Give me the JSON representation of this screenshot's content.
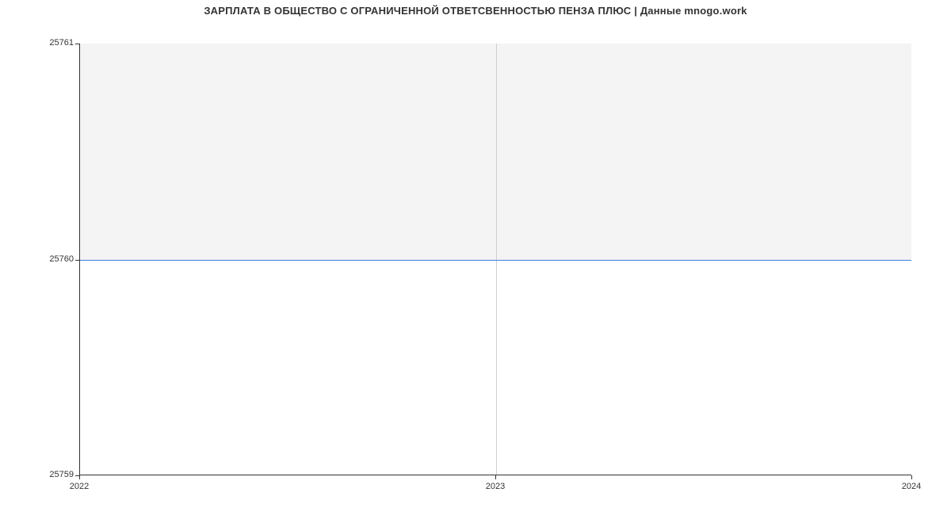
{
  "chart_data": {
    "type": "line",
    "title": "ЗАРПЛАТА В ОБЩЕСТВО С ОГРАНИЧЕННОЙ ОТВЕТСВЕННОСТЬЮ ПЕНЗА ПЛЮС | Данные mnogo.work",
    "xlabel": "",
    "ylabel": "",
    "x": [
      "2022",
      "2023",
      "2024"
    ],
    "values": [
      25760,
      25760,
      25760
    ],
    "xlim": [
      "2022",
      "2024"
    ],
    "ylim": [
      25759,
      25761
    ],
    "y_ticks": [
      "25759",
      "25760",
      "25761"
    ],
    "x_ticks": [
      "2022",
      "2023",
      "2024"
    ],
    "grid": true,
    "legend": null,
    "line_color": "#3d7fde",
    "fill_color": "#f4f4f4",
    "fill_baseline": 25760
  }
}
